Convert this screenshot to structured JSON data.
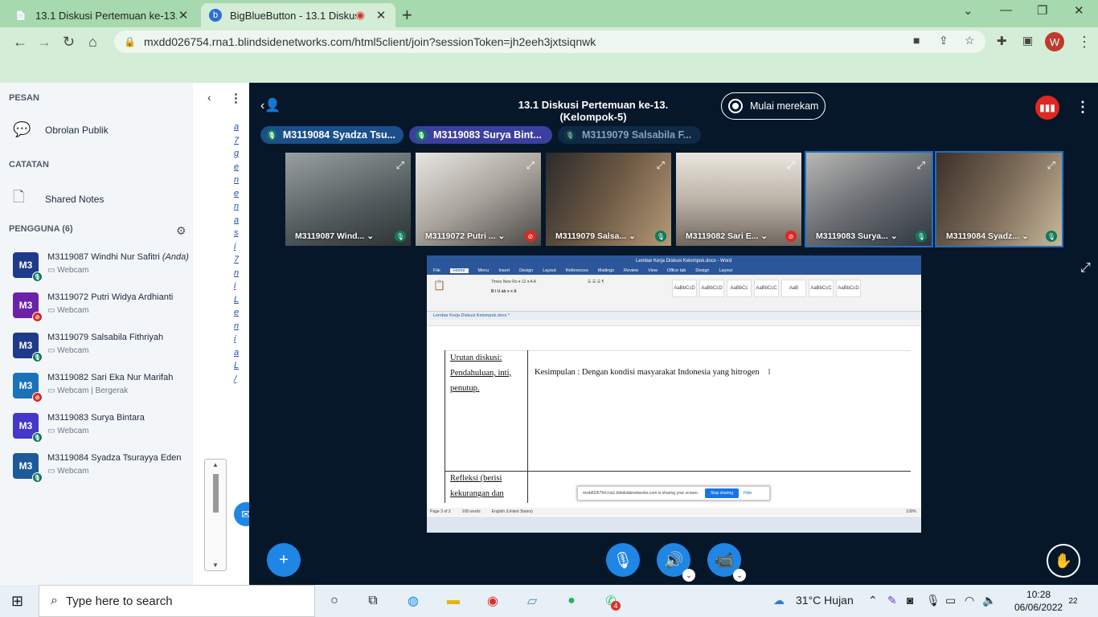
{
  "browser": {
    "tabs": [
      {
        "title": "13.1 Diskusi Pertemuan ke-13.",
        "active": false
      },
      {
        "title": "BigBlueButton - 13.1 Diskusi",
        "active": true
      }
    ],
    "url": "mxdd026754.rna1.blindsidenetworks.com/html5client/join?sessionToken=jh2eeh3jxtsiqnwk",
    "profile_initial": "W"
  },
  "sidebar": {
    "messages_title": "PESAN",
    "public_chat": "Obrolan Publik",
    "notes_title": "CATATAN",
    "shared_notes": "Shared Notes",
    "users_title": "PENGGUNA (6)",
    "users": [
      {
        "avatar": "M3",
        "name": "M3119087 Windhi Nur Safitri",
        "you": "(Anda)",
        "status": "Webcam",
        "color": "#1E3A8A",
        "mic": "on"
      },
      {
        "avatar": "M3",
        "name": "M3119072 Putri Widya Ardhianti",
        "you": "",
        "status": "Webcam",
        "color": "#6B21A8",
        "mic": "off"
      },
      {
        "avatar": "M3",
        "name": "M3119079 Salsabila Fithriyah",
        "you": "",
        "status": "Webcam",
        "color": "#1E3A8A",
        "mic": "on"
      },
      {
        "avatar": "M3",
        "name": "M3119082 Sari Eka Nur Marifah",
        "you": "",
        "status": "Webcam | Bergerak",
        "color": "#1A73B8",
        "mic": "off"
      },
      {
        "avatar": "M3",
        "name": "M3119083 Surya Bintara",
        "you": "",
        "status": "Webcam",
        "color": "#4338CA",
        "mic": "on"
      },
      {
        "avatar": "M3",
        "name": "M3119084 Syadza Tsurayya Eden",
        "you": "",
        "status": "Webcam",
        "color": "#1E5A9A",
        "mic": "on"
      }
    ]
  },
  "meeting": {
    "title": "13.1 Diskusi Pertemuan ke-13. (Kelompok-5)",
    "record_label": "Mulai merekam",
    "talkers": [
      {
        "name": "M3119084 Syadza Tsu...",
        "color": "#1A4F8A"
      },
      {
        "name": "M3119083 Surya Bint...",
        "color": "#3B3F9E"
      },
      {
        "name": "M3119079 Salsabila F...",
        "color": "#0F2A45"
      }
    ],
    "videos": [
      {
        "label": "M3119087 Wind...",
        "mic": "on",
        "bg": "linear-gradient(160deg,#9aa0a0,#50595b 60%,#2d3335)",
        "active": false
      },
      {
        "label": "M3119072 Putri ...",
        "mic": "off",
        "bg": "linear-gradient(150deg,#e8e6e2,#a9a39c 50%,#4a4745)",
        "active": false
      },
      {
        "label": "M3119079 Salsa...",
        "mic": "on",
        "bg": "linear-gradient(120deg,#2a2a2a,#6e5a45 50%,#b59a76)",
        "active": false
      },
      {
        "label": "M3119082 Sari E...",
        "mic": "off",
        "bg": "linear-gradient(180deg,#eae6df,#bcb4a8 50%,#6f6760)",
        "active": false
      },
      {
        "label": "M3119083 Surya...",
        "mic": "on",
        "bg": "linear-gradient(150deg,#b8b8b3,#6b6f74 50%,#2f3640)",
        "active": true
      },
      {
        "label": "M3119084 Syadz...",
        "mic": "on",
        "bg": "linear-gradient(120deg,#3b3028,#7a6a58 50%,#c8b89a)",
        "active": true
      }
    ]
  },
  "screenshare": {
    "word_title": "Lembar Kerja Diskusi Kelompok.docx - Word",
    "ribbon_tabs": [
      "File",
      "Home",
      "Menu",
      "Insert",
      "Design",
      "Layout",
      "References",
      "Mailings",
      "Review",
      "View",
      "Office tab",
      "Design",
      "Layout"
    ],
    "doc_tab": "Lembar Kerja Diskusi Kelompok.docx *",
    "styles": [
      "AaBbCcD",
      "AaBbCcD",
      "AaBbCc",
      "AaBbCcC",
      "AaB",
      "AaBbCcC",
      "AaBbCcD"
    ],
    "cell_left_lines": [
      "Urutan diskusi:",
      "Pendahuluan, inti,",
      "penutup."
    ],
    "cell_right": "Kesimpulan : Dengan kondisi masyarakat Indonesia yang hitrogen",
    "cell_left_lines_2": [
      "Refleksi (berisi",
      "kekurangan dan"
    ],
    "share_notice": "mxdd026754.rna1.blindsidenetworks.com is sharing your screen.",
    "stop_sharing": "Stop sharing",
    "hide": "Hide",
    "status": [
      "Page 3 of 3",
      "108 words",
      "English (United States)"
    ],
    "zoom": "100%"
  },
  "controls": {
    "plus": "+",
    "mic": "mic",
    "audio": "audio",
    "camera": "camera",
    "raise": "raise-hand"
  },
  "taskbar": {
    "search_placeholder": "Type here to search",
    "weather": "31°C  Hujan",
    "time": "10:28",
    "date": "06/06/2022",
    "notifications": "22",
    "whatsapp_badge": "4"
  }
}
